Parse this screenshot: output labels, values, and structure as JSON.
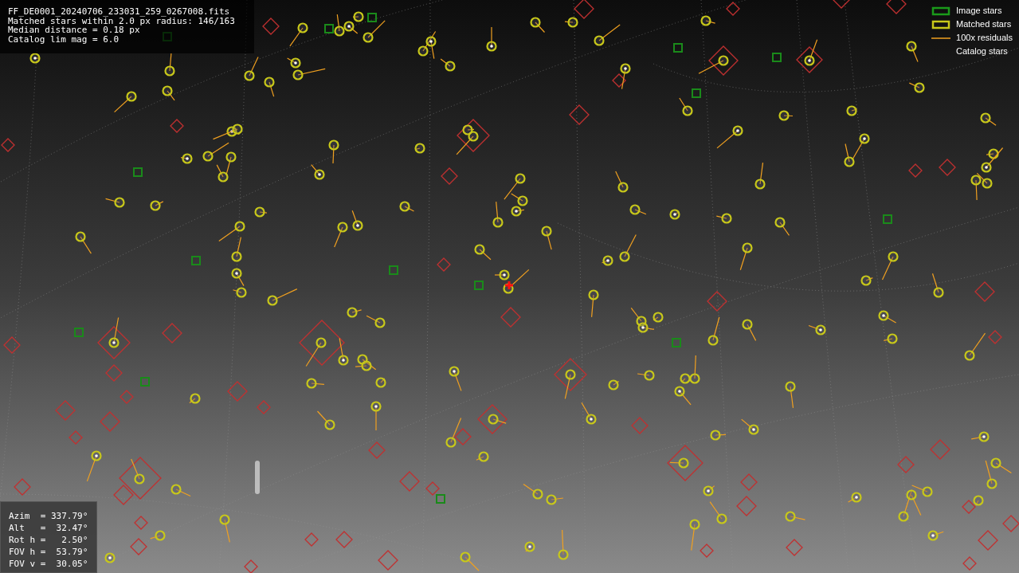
{
  "info_box": {
    "lines": [
      "FF_DE0001_20240706_233031_259_0267008.fits",
      "Matched stars within 2.0 px radius: 146/163",
      "Median distance = 0.18 px",
      "Catalog lim mag = 6.0"
    ]
  },
  "legend": [
    {
      "label": "Image stars",
      "kind": "image"
    },
    {
      "label": "Matched stars",
      "kind": "matched"
    },
    {
      "label": "100x residuals",
      "kind": "residual"
    },
    {
      "label": "Catalog stars",
      "kind": "catalog"
    }
  ],
  "pointing_box": {
    "lines": [
      "Azim  = 337.79°",
      "Alt   =  32.47°",
      "Rot h =   2.50°",
      "FOV h =  53.79°",
      "FOV v =  30.05°"
    ]
  }
}
